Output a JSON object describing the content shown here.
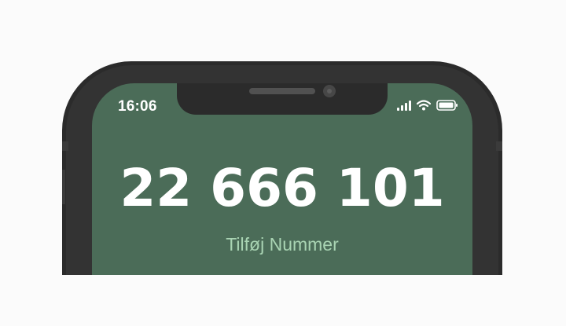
{
  "status_bar": {
    "time": "16:06",
    "icons": [
      "cellular-signal-icon",
      "wifi-icon",
      "battery-icon"
    ]
  },
  "screen": {
    "phone_number": "22 666 101",
    "add_number_label": "Tilføj Nummer"
  },
  "colors": {
    "screen_background": "#4b6c58",
    "phone_frame": "#2b2b2b",
    "number_text": "#ffffff",
    "add_number_text": "#a9d4b3"
  }
}
